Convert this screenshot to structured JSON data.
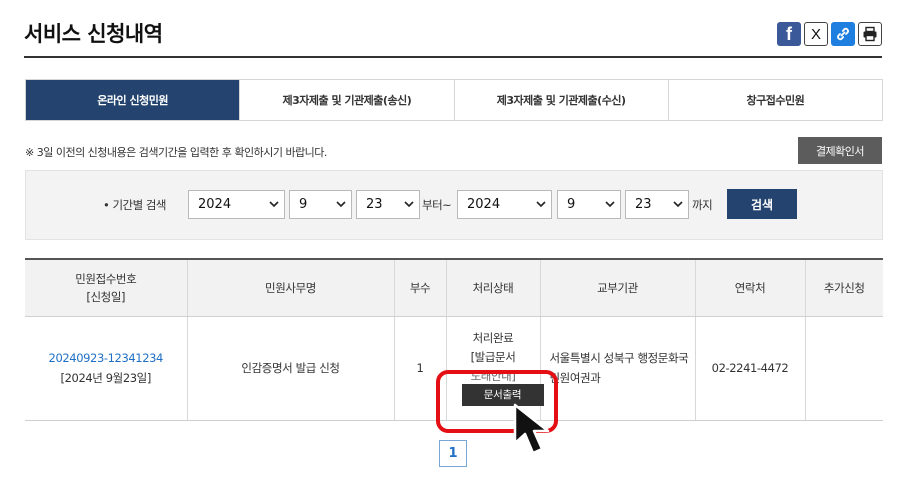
{
  "page": {
    "title": "서비스 신청내역"
  },
  "share": {
    "facebook": "f",
    "x": "X",
    "icons": [
      "facebook-icon",
      "x-icon",
      "link-icon",
      "print-icon"
    ]
  },
  "tabs": [
    {
      "label": "온라인 신청민원",
      "active": true
    },
    {
      "label": "제3자제출 및 기관제출(송신)",
      "active": false
    },
    {
      "label": "제3자제출 및 기관제출(수신)",
      "active": false
    },
    {
      "label": "창구접수민원",
      "active": false
    }
  ],
  "notice": "※ 3일 이전의 신청내용은 검색기간을 입력한 후 확인하시기 바랍니다.",
  "confirm_button": "결제확인서",
  "search": {
    "label": "• 기간별 검색",
    "from_year": "2024",
    "from_month": "9",
    "from_day": "23",
    "from_suffix": "부터~",
    "to_year": "2024",
    "to_month": "9",
    "to_day": "23",
    "to_suffix": "까지",
    "button": "검색"
  },
  "table": {
    "headers": [
      "민원접수번호",
      "[신청일]",
      "민원사무명",
      "부수",
      "처리상태",
      "교부기관",
      "연락처",
      "추가신청"
    ],
    "row": {
      "receipt_no": "20240923-12341234",
      "date": "[2024년 9월23일]",
      "name": "인감증명서 발급 신청",
      "copies": "1",
      "status_line1": "처리완료",
      "status_line2": "[발급문서",
      "status_line3": "도래안내]",
      "print_button": "문서출력",
      "org_line1": "서울특별시 성북구 행정문화국",
      "org_line2": "민원여권과",
      "phone": "02-2241-4472",
      "extra": ""
    }
  },
  "pagination": {
    "current": "1"
  },
  "colors": {
    "navy": "#24446f",
    "highlight": "#e30f15",
    "link": "#1f6fc5"
  }
}
